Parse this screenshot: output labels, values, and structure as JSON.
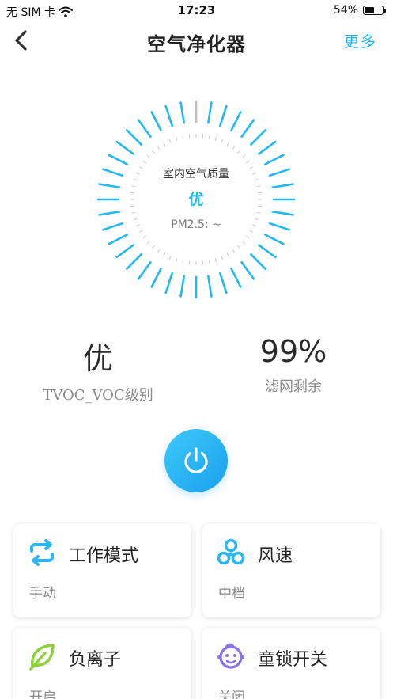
{
  "status_bar": {
    "carrier": "无 SIM 卡",
    "time": "17:23",
    "battery_percent_label": "54%",
    "battery_level": 0.54,
    "wifi_icon": "wifi-icon"
  },
  "nav": {
    "title": "空气净化器",
    "more_label": "更多",
    "back_icon": "chevron-left-icon"
  },
  "gauge": {
    "label": "室内空气质量",
    "value": "优",
    "pm_label": "PM2.5: ~",
    "accent_color": "#22b8f0"
  },
  "stats": {
    "tvoc_value": "优",
    "tvoc_label": "TVOC_VOC级别",
    "filter_value": "99%",
    "filter_label": "滤网剩余"
  },
  "power": {
    "icon": "power-icon",
    "color": "#1fb3ee"
  },
  "cards": [
    {
      "title": "工作模式",
      "value": "手动",
      "icon": "mode-swap-icon",
      "color": "#2ab6f0"
    },
    {
      "title": "风速",
      "value": "中档",
      "icon": "fan-icon",
      "color": "#2ab6f0"
    },
    {
      "title": "负离子",
      "value": "开启",
      "icon": "leaf-icon",
      "color": "#8fd33a"
    },
    {
      "title": "童锁开关",
      "value": "关闭",
      "icon": "child-face-icon",
      "color": "#8a73e8"
    }
  ]
}
